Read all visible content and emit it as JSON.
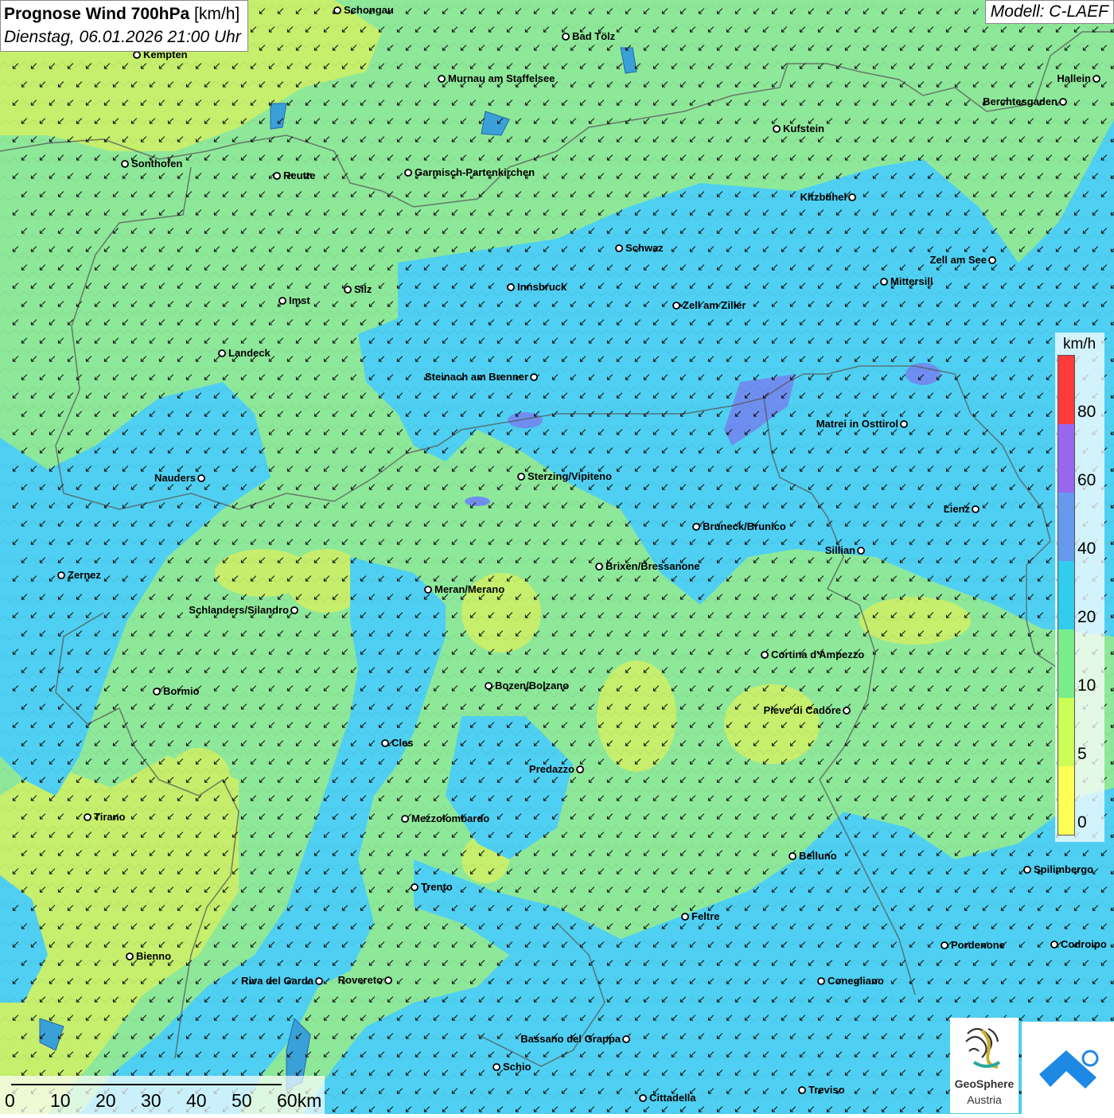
{
  "header": {
    "title_bold": "Prognose Wind 700hPa",
    "title_unit": "[km/h]",
    "datetime": "Dienstag, 06.01.2026 21:00 Uhr",
    "model": "Modell: C-LAEF"
  },
  "legend": {
    "unit": "km/h",
    "ticks": [
      "80",
      "60",
      "40",
      "20",
      "10",
      "5",
      "0"
    ],
    "colors": [
      "#ff3a3a",
      "#9966ee",
      "#6699ee",
      "#33ccee",
      "#77ee88",
      "#ccff55",
      "#ffff55"
    ]
  },
  "scale_bar": {
    "labels": [
      "0",
      "10",
      "20",
      "30",
      "40",
      "50",
      "60km"
    ]
  },
  "logo": {
    "name": "GeoSphere",
    "subtitle": "Austria"
  },
  "wind": {
    "direction": "from north-northeast",
    "arrow_glyph": "↙"
  },
  "cities": [
    "Schongau",
    "Bad Tölz",
    "Kempten",
    "Murnau am Staffelsee",
    "Hallein",
    "Berchtesgaden",
    "Kufstein",
    "Sonthofen",
    "Reutte",
    "Garmisch-Partenkirchen",
    "Kitzbühel",
    "Schwaz",
    "Zell am See",
    "Mittersill",
    "Innsbruck",
    "Silz",
    "Imst",
    "Zell am Ziller",
    "Landeck",
    "Steinach am Brenner",
    "Matrei in Osttirol",
    "Nauders",
    "Sterzing/Vipiteno",
    "Lienz",
    "Bruneck/Brunico",
    "Sillian",
    "Brixen/Bressanone",
    "Zernez",
    "Meran/Merano",
    "Schlanders/Silandro",
    "Cortina d'Ampezzo",
    "Bozen/Bolzano",
    "Bormio",
    "Pieve di Cadore",
    "Cles",
    "Predazzo",
    "Tirano",
    "Mezzolombardo",
    "Belluno",
    "Spilimbergo",
    "Trento",
    "Feltre",
    "Pordenone",
    "Codroipo",
    "Bienno",
    "Riva del Garda",
    "Rovereto",
    "Conegliano",
    "Bassano del Grappa",
    "Schio",
    "Treviso",
    "Cittadella"
  ]
}
